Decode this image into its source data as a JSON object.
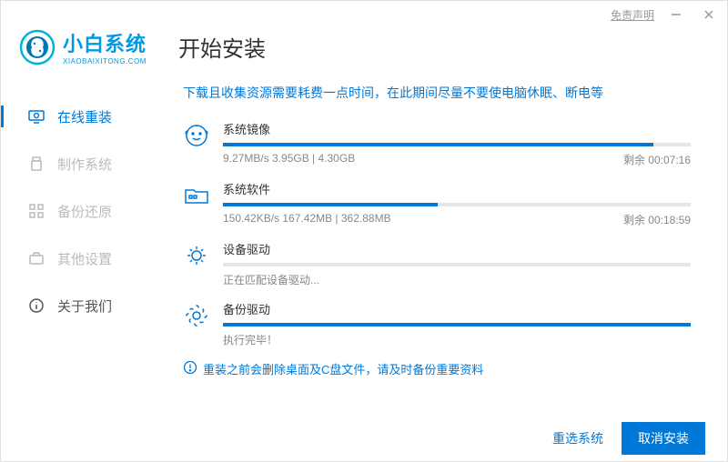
{
  "titlebar": {
    "disclaimer": "免责声明"
  },
  "brand": {
    "name": "小白系统",
    "sub": "XIAOBAIXITONG.COM"
  },
  "page_title": "开始安装",
  "sidebar": {
    "items": [
      {
        "label": "在线重装"
      },
      {
        "label": "制作系统"
      },
      {
        "label": "备份还原"
      },
      {
        "label": "其他设置"
      },
      {
        "label": "关于我们"
      }
    ]
  },
  "tip": "下载且收集资源需要耗费一点时间，在此期间尽量不要使电脑休眠、断电等",
  "tasks": [
    {
      "title": "系统镜像",
      "progress_pct": 92,
      "stats": "9.27MB/s 3.95GB | 4.30GB",
      "remain": "剩余 00:07:16"
    },
    {
      "title": "系统软件",
      "progress_pct": 46,
      "stats": "150.42KB/s 167.42MB | 362.88MB",
      "remain": "剩余 00:18:59"
    },
    {
      "title": "设备驱动",
      "progress_pct": 0,
      "stats": "正在匹配设备驱动...",
      "remain": ""
    },
    {
      "title": "备份驱动",
      "progress_pct": 100,
      "stats": "执行完毕！",
      "remain": ""
    }
  ],
  "warning": "重装之前会删除桌面及C盘文件，请及时备份重要资料",
  "footer": {
    "reselect": "重选系统",
    "cancel": "取消安装"
  }
}
